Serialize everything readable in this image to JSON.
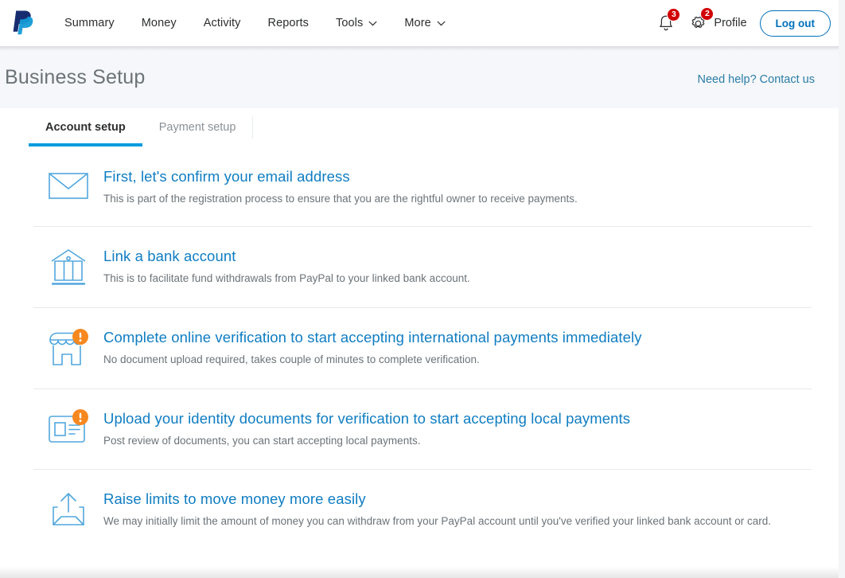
{
  "brand": {
    "logo_name": "paypal-logo",
    "primary_blue": "#0070ba",
    "accent_blue": "#009cde",
    "link_blue": "#0f7dc2",
    "badge_red": "#d20000",
    "warning_orange": "#f6881f"
  },
  "nav": {
    "items": [
      {
        "label": "Summary",
        "has_caret": false
      },
      {
        "label": "Money",
        "has_caret": false
      },
      {
        "label": "Activity",
        "has_caret": false
      },
      {
        "label": "Reports",
        "has_caret": false
      },
      {
        "label": "Tools",
        "has_caret": true
      },
      {
        "label": "More",
        "has_caret": true
      }
    ],
    "notifications": {
      "icon": "bell-icon",
      "badge_count": "3"
    },
    "settings": {
      "icon": "gear-icon",
      "badge_count": "2"
    },
    "profile_label": "Profile",
    "logout_label": "Log out"
  },
  "header": {
    "title": "Business Setup",
    "help_link": "Need help? Contact us"
  },
  "tabs": [
    {
      "label": "Account setup",
      "active": true
    },
    {
      "label": "Payment setup",
      "active": false
    }
  ],
  "setup_items": [
    {
      "icon": "envelope-icon",
      "title": "First, let's confirm your email address",
      "description": "This is part of the registration process to ensure that you are the rightful owner to receive payments.",
      "alert": false
    },
    {
      "icon": "bank-icon",
      "title": "Link a bank account",
      "description": "This is to facilitate fund withdrawals from PayPal to your linked bank account.",
      "alert": false
    },
    {
      "icon": "storefront-icon",
      "title": "Complete online verification to start accepting international payments immediately",
      "description": "No document upload required, takes couple of minutes to complete verification.",
      "alert": true
    },
    {
      "icon": "id-card-icon",
      "title": "Upload your identity documents for verification to start accepting local payments",
      "description": "Post review of documents, you can start accepting local payments.",
      "alert": true
    },
    {
      "icon": "upload-tray-icon",
      "title": "Raise limits to move money more easily",
      "description": "We may initially limit the amount of money you can withdraw from your PayPal account until you've verified your linked bank account or card.",
      "alert": false
    }
  ]
}
